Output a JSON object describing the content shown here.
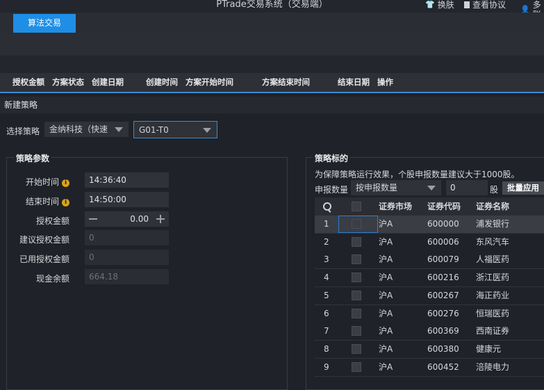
{
  "window": {
    "title": "PTrade交易系统（交易端）",
    "skin_label": "换肤",
    "agreement_label": "查看协议",
    "user_label": "多账"
  },
  "tabs": [
    {
      "label": "算法交易",
      "active": true
    }
  ],
  "table_header": {
    "columns": [
      "授权金额",
      "方案状态",
      "创建日期",
      "创建时间",
      "方案开始时间",
      "方案结束时间",
      "结束日期",
      "操作"
    ]
  },
  "new_strategy": {
    "title": "新建策略",
    "select_label": "选择策略",
    "provider_value": "金纳科技（快速",
    "strategy_value": "G01-T0"
  },
  "params": {
    "legend": "策略参数",
    "start_time_label": "开始时间",
    "start_time_value": "14:36:40",
    "end_time_label": "结束时间",
    "end_time_value": "14:50:00",
    "auth_amount_label": "授权金额",
    "auth_amount_value": "0.00",
    "suggest_amount_label": "建议授权金额",
    "suggest_amount_value": "0",
    "used_amount_label": "已用授权金额",
    "used_amount_value": "0",
    "cash_label": "现金余额",
    "cash_value": "664.18"
  },
  "targets": {
    "legend": "策略标的",
    "notice": "为保障策略运行效果，个股申报数量建议大于1000股。",
    "qty_label": "申报数量",
    "qty_mode": "按申报数量",
    "qty_value": "0",
    "qty_unit": "股",
    "batch_button": "批量应用",
    "columns": {
      "market": "证券市场",
      "code": "证券代码",
      "name": "证券名称"
    },
    "rows": [
      {
        "no": "1",
        "market": "沪A",
        "code": "600000",
        "name": "浦发银行"
      },
      {
        "no": "2",
        "market": "沪A",
        "code": "600006",
        "name": "东风汽车"
      },
      {
        "no": "3",
        "market": "沪A",
        "code": "600079",
        "name": "人福医药"
      },
      {
        "no": "4",
        "market": "沪A",
        "code": "600216",
        "name": "浙江医药"
      },
      {
        "no": "5",
        "market": "沪A",
        "code": "600267",
        "name": "海正药业"
      },
      {
        "no": "6",
        "market": "沪A",
        "code": "600276",
        "name": "恒瑞医药"
      },
      {
        "no": "7",
        "market": "沪A",
        "code": "600369",
        "name": "西南证券"
      },
      {
        "no": "8",
        "market": "沪A",
        "code": "600380",
        "name": "健康元"
      },
      {
        "no": "9",
        "market": "沪A",
        "code": "600452",
        "name": "涪陵电力"
      }
    ]
  },
  "icons": {
    "shirt": "shirt-icon",
    "doc": "document-icon",
    "user": "user-icon",
    "search": "search-icon",
    "info": "info-icon"
  },
  "colors": {
    "accent": "#1e8ee6",
    "background": "#1f2228",
    "info": "#d9a21b"
  }
}
